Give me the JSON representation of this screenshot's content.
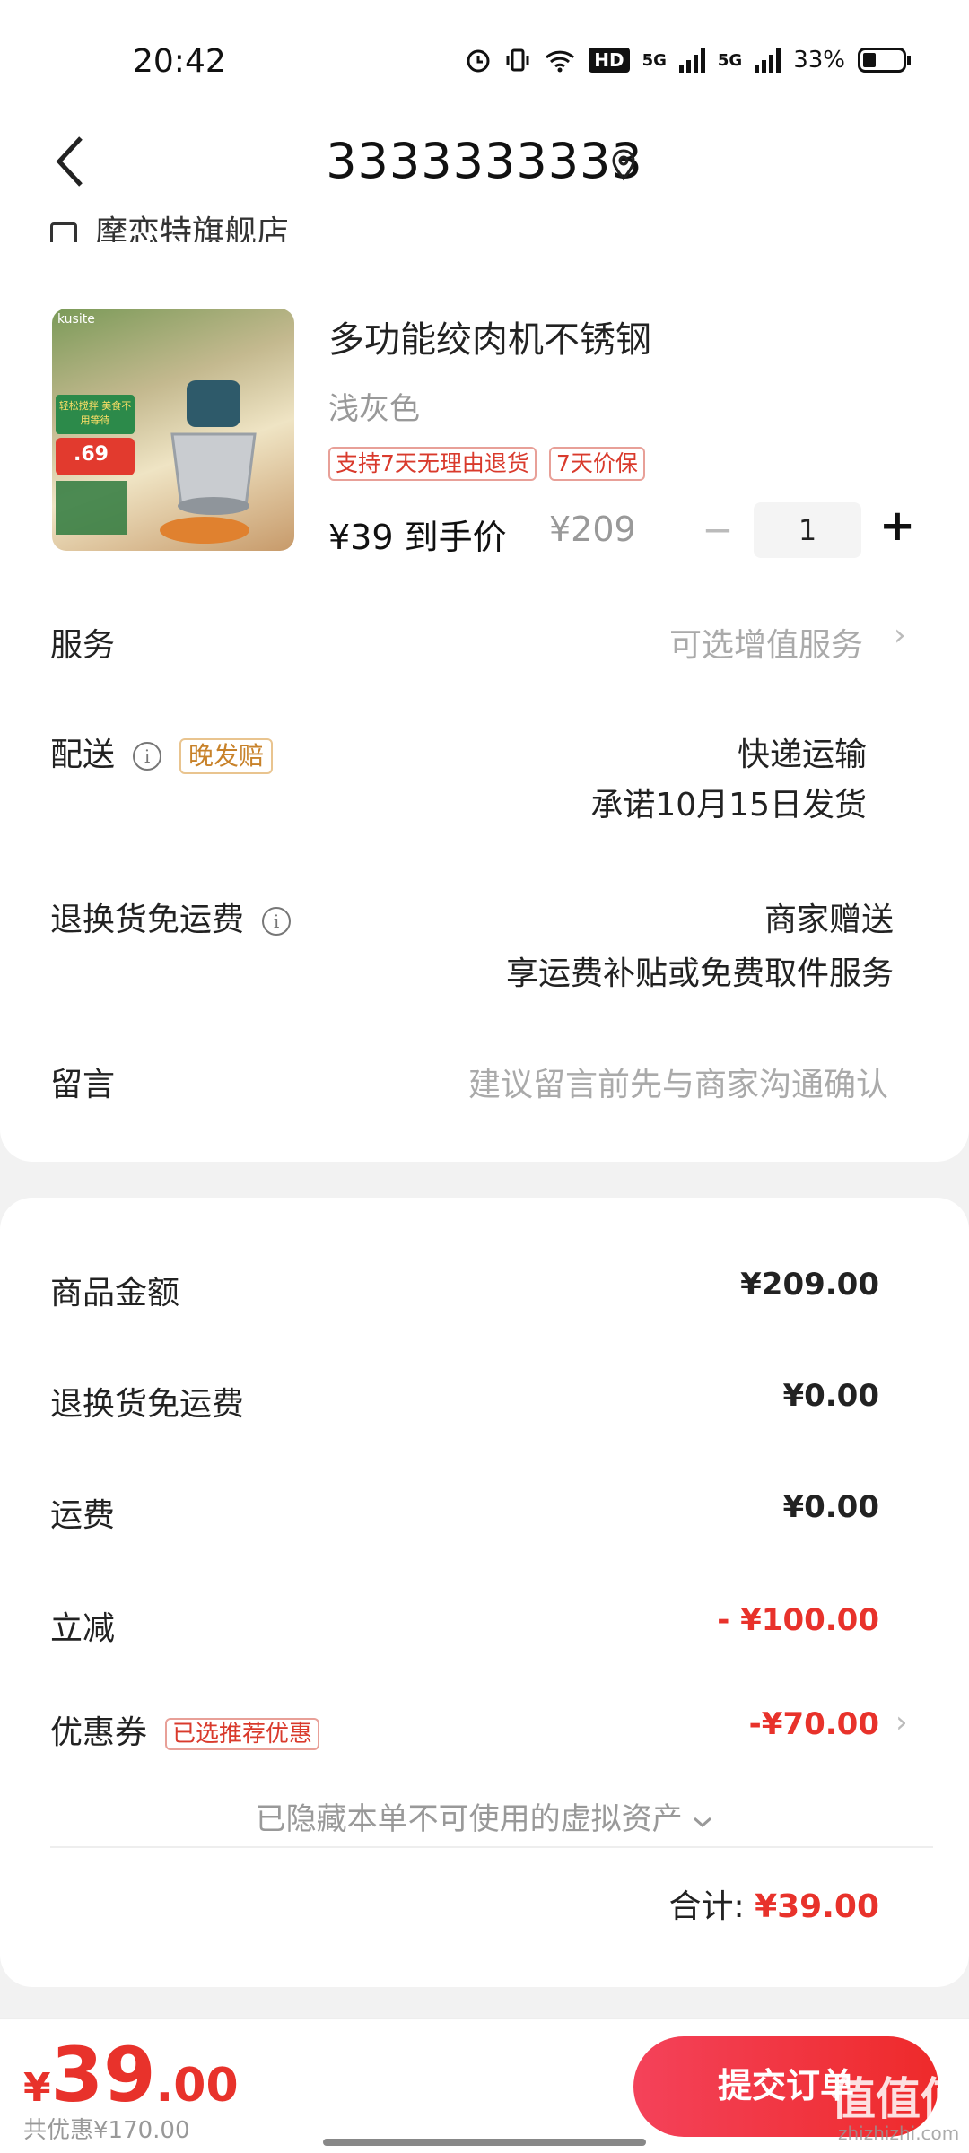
{
  "status": {
    "time": "20:42",
    "net1": "5G",
    "net2": "5G",
    "hd": "HD",
    "battery": "33%"
  },
  "nav": {
    "title": "3333333333"
  },
  "store": {
    "name": "摩恋特旗舰店"
  },
  "product": {
    "image_logo": "kusite",
    "image_badge": "轻松搅拌 美食不用等待",
    "image_price": ".69",
    "title": "多功能绞肉机不锈钢",
    "color": "浅灰色",
    "tags": [
      "支持7天无理由退货",
      "7天价保"
    ],
    "price": "¥39 到手价",
    "old_price": "¥209",
    "qty_minus": "−",
    "quantity": "1",
    "qty_plus": "+"
  },
  "rows": {
    "service_label": "服务",
    "service_value": "可选增值服务",
    "delivery_label": "配送",
    "delivery_badge": "晚发赔",
    "delivery_value1": "快递运输",
    "delivery_value2": "承诺10月15日发货",
    "return_label": "退换货免运费",
    "return_value1": "商家赠送",
    "return_value2": "享运费补贴或免费取件服务",
    "message_label": "留言",
    "message_placeholder": "建议留言前先与商家沟通确认"
  },
  "summary": {
    "goods_label": "商品金额",
    "goods_value": "¥209.00",
    "return_label": "退换货免运费",
    "return_value": "¥0.00",
    "shipping_label": "运费",
    "shipping_value": "¥0.00",
    "discount_label": "立减",
    "discount_value": "- ¥100.00",
    "coupon_label": "优惠券",
    "coupon_badge": "已选推荐优惠",
    "coupon_value": "-¥70.00",
    "hidden_assets": "已隐藏本单不可使用的虚拟资产",
    "total_label": "合计:",
    "total_value": "¥39.00"
  },
  "bottom": {
    "currency": "¥",
    "price_int": "39",
    "price_dec": ".00",
    "saved": "共优惠¥170.00",
    "submit_label": "提交订单",
    "watermark": "值值值",
    "watermark_sub": "zhizhizhi.com"
  },
  "colors": {
    "accent_red": "#e8322b",
    "badge_orange": "#c8822a"
  }
}
